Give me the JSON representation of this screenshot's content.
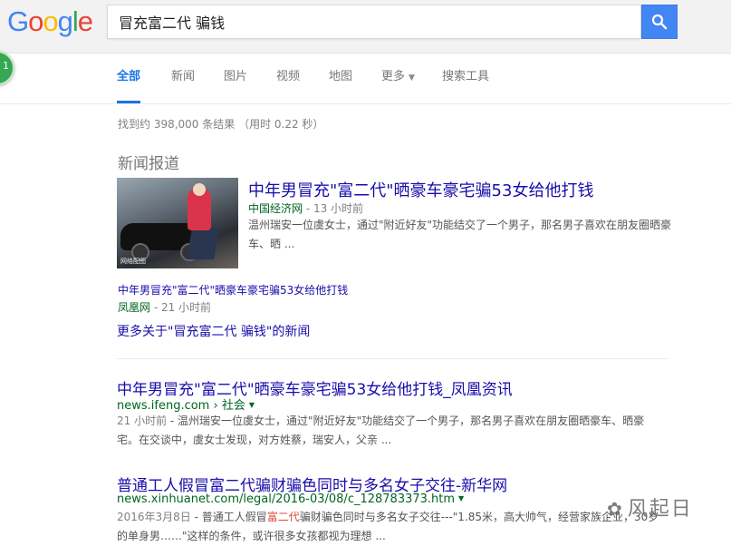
{
  "header": {
    "logo_letters": [
      {
        "ch": "G",
        "color": "#4285f4"
      },
      {
        "ch": "o",
        "color": "#ea4335"
      },
      {
        "ch": "o",
        "color": "#fbbc05"
      },
      {
        "ch": "g",
        "color": "#4285f4"
      },
      {
        "ch": "l",
        "color": "#34a853"
      },
      {
        "ch": "e",
        "color": "#ea4335"
      }
    ],
    "search_value": "冒充富二代 骗钱",
    "search_icon": "search-icon",
    "accent": "#4285f4",
    "apps_badge": "1"
  },
  "tabs": [
    {
      "label": "全部",
      "active": true
    },
    {
      "label": "新闻"
    },
    {
      "label": "图片"
    },
    {
      "label": "视频"
    },
    {
      "label": "地图"
    },
    {
      "label": "更多"
    },
    {
      "label": "搜索工具"
    }
  ],
  "stats": "找到约 398,000 条结果 （用时 0.22 秒）",
  "news": {
    "section_title": "新闻报道",
    "image_caption": "网络配图",
    "title": "中年男冒充\"富二代\"晒豪车豪宅骗53女给他打钱",
    "source": "中国经济网",
    "time": " - 13 小时前",
    "snippet": "温州瑞安一位虞女士，通过\"附近好友\"功能结交了一个男子，那名男子喜欢在朋友圈晒豪车、晒 ...",
    "sub_title": "中年男冒充\"富二代\"晒豪车豪宅骗53女给他打钱",
    "sub_source": "凤凰网",
    "sub_time": " - 21 小时前",
    "more_link": "更多关于\"冒充富二代 骗钱\"的新闻"
  },
  "results": [
    {
      "title": "中年男冒充\"富二代\"晒豪车豪宅骗53女给他打钱_凤凰资讯",
      "url": "news.ifeng.com › 社会",
      "date": "21 小时前",
      "snippet": " - 温州瑞安一位虞女士，通过\"附近好友\"功能结交了一个男子，那名男子喜欢在朋友圈晒豪车、晒豪宅。在交谈中，虞女士发现，对方姓蔡，瑞安人，父亲 ..."
    },
    {
      "title": "普通工人假冒富二代骗财骗色同时与多名女子交往-新华网",
      "url": "news.xinhuanet.com/legal/2016-03/08/c_128783373.htm",
      "date": "2016年3月8日",
      "snippet_pre": " - 普通工人假冒",
      "snippet_hl": "富二代",
      "snippet_post": "骗财骗色同时与多名女子交往---\"1.85米，高大帅气，经营家族企业，30岁的单身男……\"这样的条件，或许很多女孩都视为理想 ..."
    }
  ],
  "watermark": "风起日"
}
